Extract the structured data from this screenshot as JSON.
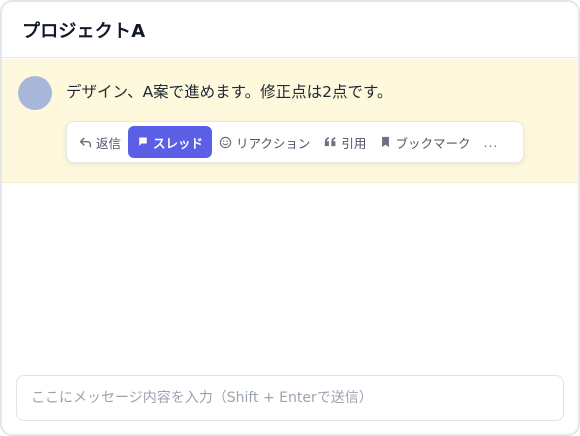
{
  "header": {
    "title": "プロジェクトA"
  },
  "message": {
    "text": "デザイン、A案で進めます。修正点は2点です。"
  },
  "actions": {
    "reply": {
      "label": "返信",
      "icon": "reply-arrow-icon"
    },
    "thread": {
      "label": "スレッド",
      "icon": "flag-icon",
      "active": true
    },
    "reaction": {
      "label": "リアクション",
      "icon": "smiley-icon"
    },
    "quote": {
      "label": "引用",
      "icon": "quote-icon"
    },
    "bookmark": {
      "label": "ブックマーク",
      "icon": "bookmark-icon"
    },
    "more": {
      "label": "...",
      "icon": "more-icon"
    }
  },
  "composer": {
    "placeholder": "ここにメッセージ内容を入力（Shift + Enterで送信）",
    "value": ""
  },
  "colors": {
    "accent": "#5a5fe6",
    "highlight_bg": "#fef8dc",
    "avatar": "#a9b7da"
  }
}
